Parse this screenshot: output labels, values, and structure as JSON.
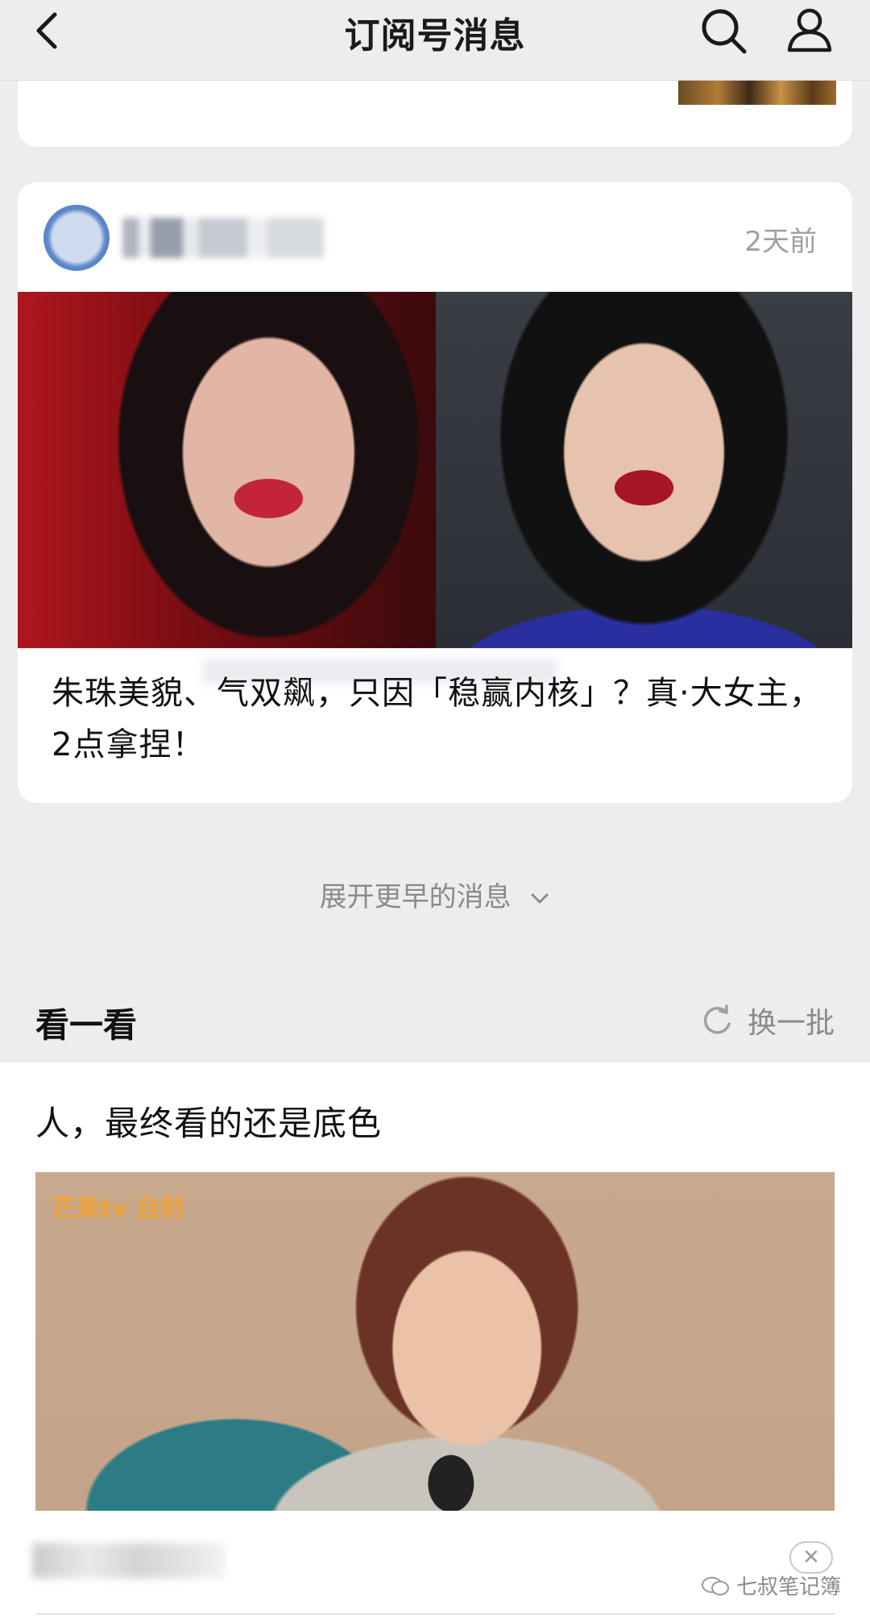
{
  "header": {
    "title": "订阅号消息"
  },
  "card": {
    "timestamp": "2天前",
    "article_title": "朱珠美貌、气双飙，只因「稳赢内核」？真·大女主，2点拿捏！"
  },
  "expand_label": "展开更早的消息",
  "section": {
    "title": "看一看",
    "refresh_label": "换一批"
  },
  "feed": {
    "title": "人，最终看的还是底色",
    "image_logo_text": "芒果tv 自制",
    "close_label": "✕"
  },
  "watermark": "七叔笔记簿",
  "colors": {
    "background": "#ededed",
    "card": "#ffffff",
    "muted": "#8a8a8a"
  }
}
